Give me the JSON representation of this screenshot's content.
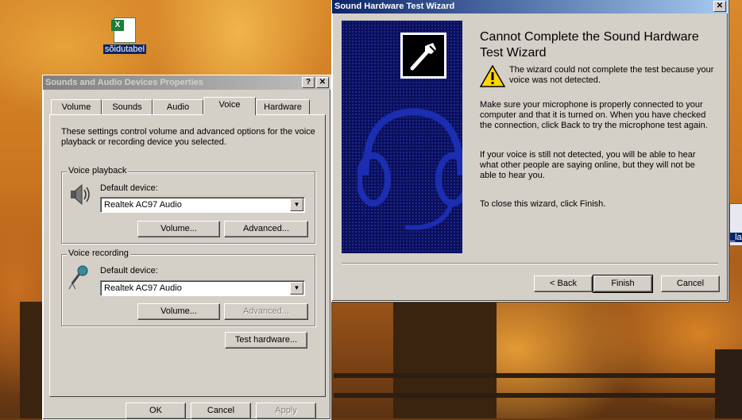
{
  "desktop": {
    "icon_label": "sõidutabel",
    "icon_badge": "X",
    "partial_label": "_la"
  },
  "sounds_dialog": {
    "title": "Sounds and Audio Devices Properties",
    "help_btn": "?",
    "close_btn": "✕",
    "tabs": [
      {
        "label": "Volume"
      },
      {
        "label": "Sounds"
      },
      {
        "label": "Audio"
      },
      {
        "label": "Voice"
      },
      {
        "label": "Hardware"
      }
    ],
    "description": "These settings control volume and advanced options for the voice playback or recording device you selected.",
    "playback": {
      "group_title": "Voice playback",
      "device_label": "Default device:",
      "device_value": "Realtek AC97 Audio",
      "volume_btn": "Volume...",
      "advanced_btn": "Advanced..."
    },
    "recording": {
      "group_title": "Voice recording",
      "device_label": "Default device:",
      "device_value": "Realtek AC97 Audio",
      "volume_btn": "Volume...",
      "advanced_btn": "Advanced..."
    },
    "test_hardware_btn": "Test hardware...",
    "ok_btn": "OK",
    "cancel_btn": "Cancel",
    "apply_btn": "Apply"
  },
  "wizard": {
    "title": "Sound Hardware Test Wizard",
    "close_btn": "✕",
    "heading": "Cannot Complete the Sound Hardware Test Wizard",
    "warning": "The wizard could not complete the test because your voice was not detected.",
    "para1": "Make sure your microphone is properly connected to your computer and that it is turned on. When you have checked the connection, click Back to try the microphone test again.",
    "para2": "If your voice is still not detected, you will be able to hear what other people are saying online, but they will not be able to hear you.",
    "para3": "To close this wizard, click Finish.",
    "back_btn": "< Back",
    "finish_btn": "Finish",
    "cancel_btn": "Cancel"
  }
}
